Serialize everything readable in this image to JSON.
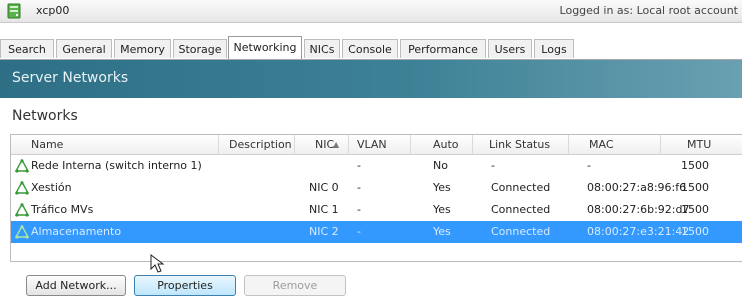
{
  "window": {
    "host_name": "xcp00",
    "login_info": "Logged in as: Local root account"
  },
  "tabs": [
    {
      "label": "Search"
    },
    {
      "label": "General"
    },
    {
      "label": "Memory"
    },
    {
      "label": "Storage"
    },
    {
      "label": "Networking",
      "active": true
    },
    {
      "label": "NICs"
    },
    {
      "label": "Console"
    },
    {
      "label": "Performance"
    },
    {
      "label": "Users"
    },
    {
      "label": "Logs"
    }
  ],
  "banner": {
    "title": "Server Networks"
  },
  "networks": {
    "section_title": "Networks",
    "columns": [
      "Name",
      "Description",
      "NIC",
      "VLAN",
      "Auto",
      "Link Status",
      "MAC",
      "MTU"
    ],
    "sort_indicator": "▲",
    "rows": [
      {
        "name": "Rede Interna (switch interno 1)",
        "description": "",
        "nic": "",
        "vlan": "-",
        "auto": "No",
        "link_status": "-",
        "mac": "-",
        "mtu": "1500",
        "selected": false
      },
      {
        "name": "Xestión",
        "description": "",
        "nic": "NIC 0",
        "vlan": "-",
        "auto": "Yes",
        "link_status": "Connected",
        "mac": "08:00:27:a8:96:f6",
        "mtu": "1500",
        "selected": false
      },
      {
        "name": "Tráfico MVs",
        "description": "",
        "nic": "NIC 1",
        "vlan": "-",
        "auto": "Yes",
        "link_status": "Connected",
        "mac": "08:00:27:6b:92:d7",
        "mtu": "1500",
        "selected": false
      },
      {
        "name": "Almacenamento",
        "description": "",
        "nic": "NIC 2",
        "vlan": "-",
        "auto": "Yes",
        "link_status": "Connected",
        "mac": "08:00:27:e3:21:42",
        "mtu": "1500",
        "selected": true
      }
    ]
  },
  "buttons": {
    "add_network": "Add Network...",
    "properties": "Properties",
    "remove": "Remove"
  },
  "icons": {
    "host": "server-green-icon",
    "network": "network-icon",
    "cursor": "mouse-pointer-icon"
  },
  "colors": {
    "banner": "#2e6f86",
    "selection": "#3399ff",
    "network_icon": "#3a9a3a"
  }
}
